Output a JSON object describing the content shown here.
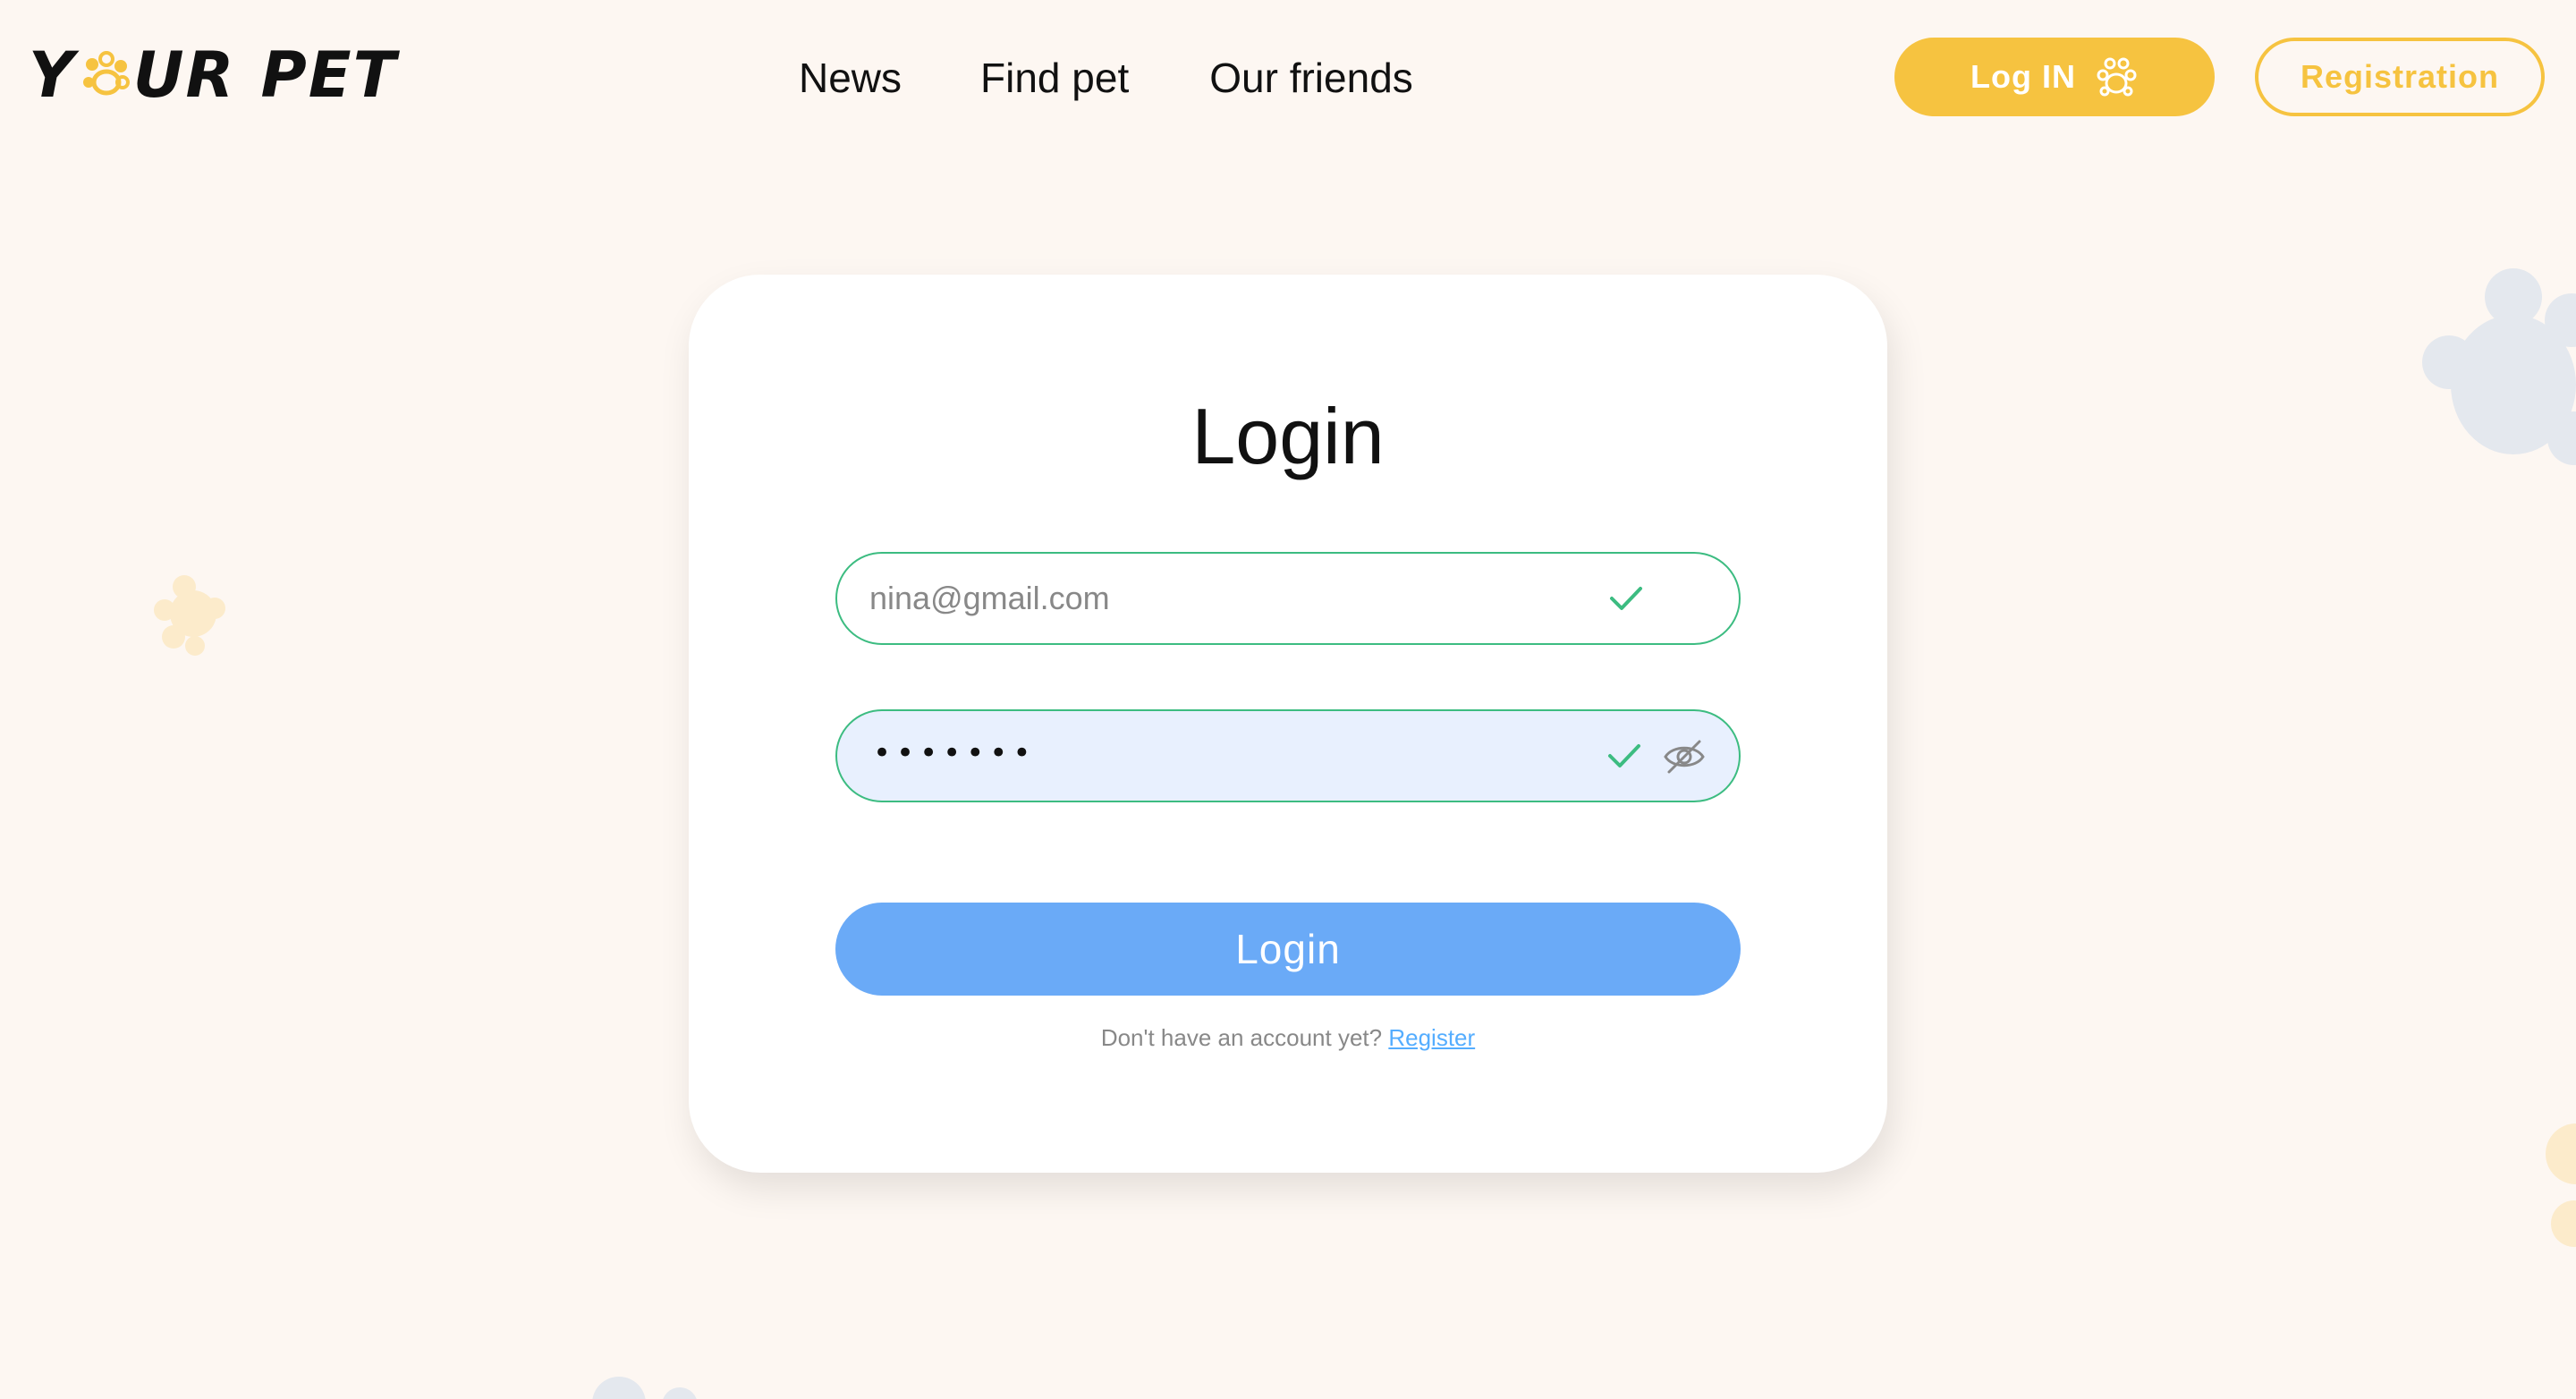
{
  "header": {
    "logo": {
      "word1_start": "Y",
      "word1_end": "UR",
      "word2": "PET"
    },
    "nav": {
      "news": "News",
      "find_pet": "Find pet",
      "our_friends": "Our friends"
    },
    "login_button": "Log IN",
    "registration_button": "Registration"
  },
  "form": {
    "title": "Login",
    "email_value": "nina@gmail.com",
    "password_dots": "•••••••",
    "submit_label": "Login",
    "footer_text": "Don't have an account yet?",
    "footer_link": "Register"
  },
  "colors": {
    "background": "#FDF7F2",
    "accent_yellow": "#F6C340",
    "valid_green": "#3CBC81",
    "button_blue": "#6AAAF7",
    "link_blue": "#54ADFF",
    "password_fill": "#E8F0FE"
  },
  "icons": {
    "login_button_icon": "paw-icon",
    "field_valid_icon": "check-icon",
    "password_toggle_icon": "eye-off-icon"
  }
}
